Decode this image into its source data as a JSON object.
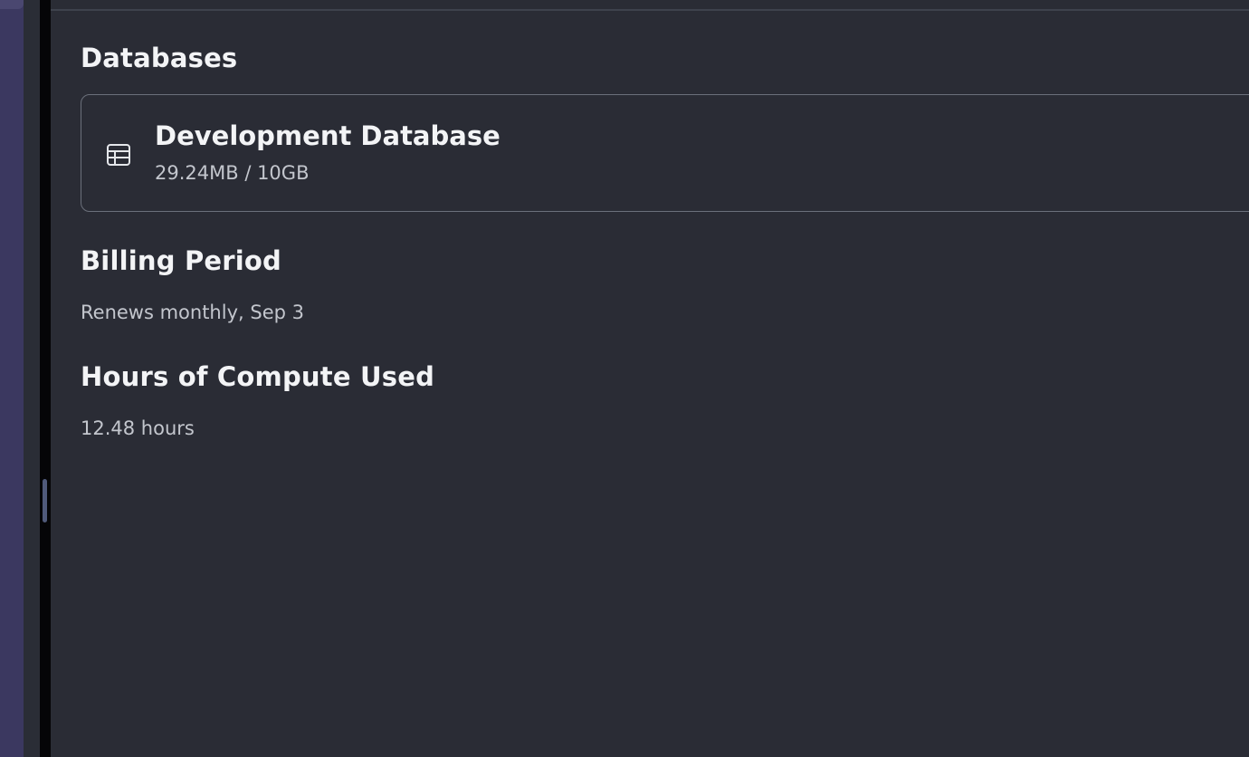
{
  "databases": {
    "title": "Databases",
    "items": [
      {
        "name": "Development Database",
        "usage": "29.24MB / 10GB",
        "icon": "table-icon"
      }
    ]
  },
  "billing": {
    "title": "Billing Period",
    "value": "Renews monthly, Sep 3"
  },
  "compute": {
    "title": "Hours of Compute Used",
    "value": "12.48 hours"
  },
  "colors": {
    "background": "#2a2c35",
    "sidebar": "#3b3860",
    "card_border": "#6b707b",
    "heading": "#f3f4f6",
    "muted_text": "#c3c6cd"
  }
}
